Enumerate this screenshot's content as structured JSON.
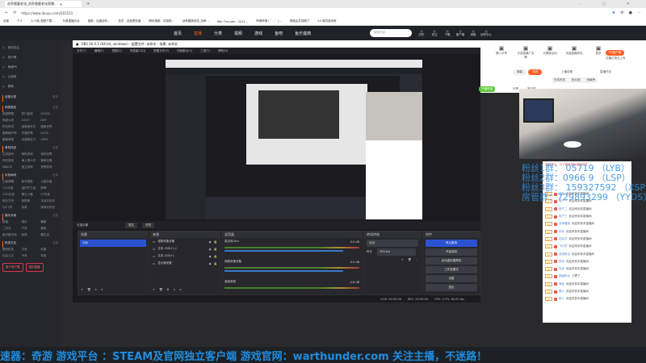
{
  "browser": {
    "tab_title": "战争雷霆老张_战争雷霆老张直播...",
    "url": "https://www.douyu.com/201521",
    "bookmarks": [
      "百度",
      "个人",
      "人人网_视频下载...",
      "抖音直播平台",
      "度娘 - 百度百科...",
      "花花 - 这就是知道",
      "腾讯视频 - 中国领...",
      "战争雷霆老张_战争...",
      "War Thunder - 2021...",
      "哔哩哔哩 ( ゜- ゜)...",
      "视频会员到期了",
      "24 单机游戏网"
    ]
  },
  "douyu": {
    "nav": [
      "首页",
      "直播",
      "分类",
      "视频",
      "游戏",
      "鱼吧",
      "鱼乐盛典"
    ],
    "search_placeholder": "搜索内容",
    "header_icons": [
      "历史",
      "关注",
      "下载",
      "客户端",
      "消息",
      "创作中心"
    ],
    "sidebar": {
      "top": [
        "我的关注",
        "排行榜",
        "鱼塘PK",
        "云游戏",
        "赛事"
      ],
      "sections": [
        {
          "title": "全部分类",
          "more": "更多",
          "items": []
        },
        {
          "title": "网游竞技",
          "more": "全部",
          "items": [
            "英雄联盟",
            "热门游戏",
            "DOTA2",
            "穿越火线",
            "CSGO",
            "DNF",
            "炉石传说",
            "逃离塔科夫",
            "魔兽世界",
            "暗黑破坏神",
            "守望先锋",
            "DOTA",
            "魔兽争霸",
            "天涯明月刀",
            "APEX"
          ]
        },
        {
          "title": "单机热游",
          "more": "全部",
          "items": [
            "主机游戏",
            "单机游戏",
            "我的世界",
            "怀旧游戏",
            "海上狼人杀",
            "使命召唤",
            "NBA2K",
            "独立游戏",
            "恐怖游戏"
          ]
        },
        {
          "title": "手游休闲",
          "more": "全部",
          "items": [
            "王者荣耀",
            "和平精英",
            "火影忍者",
            "LOL手游",
            "金铲铲之战",
            "原神",
            "COD手游",
            "第五人格",
            "CF手游",
            "明日方舟",
            "阴阳师",
            "决战平安京",
            "QQ飞车",
            "传奇",
            "球球大作战"
          ]
        },
        {
          "title": "娱乐天地",
          "more": "全部",
          "items": [
            "颜值",
            "音乐",
            "舞蹈",
            "二次元",
            "户外",
            "美食",
            "鱼乐星天地",
            "影视",
            "趣生活"
          ]
        },
        {
          "title": "科技文化",
          "more": "全部",
          "items": [
            "数码科技",
            "文化",
            "科普",
            "社会人文",
            "汽车",
            "军事"
          ]
        }
      ],
      "buttons": [
        "客户端下载",
        "我的直播"
      ]
    },
    "right": {
      "icons": [
        "猜人分享",
        "手游直播广告牌",
        "大蛋糕活动",
        "安装直播伴侣",
        "更多"
      ],
      "pc_button": "PC客户端",
      "pc_sub": "边播边录边上传",
      "toggle": [
        "弹幕",
        "关闭"
      ],
      "links": [
        "上播攻略",
        "直播任务"
      ],
      "tabs": [
        "在线贵宾",
        "粉丝团",
        "贡献榜"
      ],
      "green_btn": "开通贵族",
      "share": "分享",
      "report": "客户端"
    }
  },
  "obs": {
    "title": "OBS 26.0.1 (64-bit, windows) - 配置文件: 未命名 - 场景: 未命名",
    "menu": [
      "文件(F)",
      "编辑(E)",
      "视图(V)",
      "停靠窗口(D)",
      "配置文件(P)",
      "场景集合(S)",
      "工具(T)",
      "帮助(H)"
    ],
    "no_source": "无选中源",
    "props": "属性",
    "filters": "滤镜",
    "scenes_title": "场景",
    "scene": "场景",
    "sources_title": "来源",
    "sources": [
      "视频采集设备",
      "文本 (GDI+) 2",
      "文本 (GDI+)",
      "显示器采集"
    ],
    "mixer_title": "混音器",
    "mixer": [
      {
        "name": "麦克风/Aux",
        "db": "0.0 dB"
      },
      {
        "name": "视频采集设备",
        "db": "0.0 dB"
      },
      {
        "name": "桌面音频",
        "db": "-4.8 dB"
      }
    ],
    "transitions_title": "转场特效",
    "transition": "淡出",
    "duration_label": "时长",
    "duration": "300 ms",
    "controls_title": "控件",
    "controls": [
      "停止推流",
      "开始录制",
      "启动虚拟摄像机",
      "工作室模式",
      "设置",
      "退出"
    ],
    "status": {
      "live": "LIVE: 00:00:00",
      "rec": "REC: 00:00:00",
      "cpu": "CPU: 3.7%, 60.00 fps"
    }
  },
  "fans": [
    "粉丝1群：    05719 （LYB）",
    "粉丝2群：0966   9  （LSP）",
    "粉丝3群： 159327592 （XSP）",
    "房管群：729893299 （YYDS）"
  ],
  "chat": {
    "notice": "系统提示：为了倡导绿色直播环境...",
    "messages": [
      {
        "lvl": "LV",
        "user": "游客",
        "text": "欢迎来到本直播间"
      },
      {
        "lvl": "LV",
        "user": "用户一",
        "text": "欢迎来到本直播间"
      },
      {
        "lvl": "LV",
        "user": "用户二",
        "text": "欢迎来到本直播间"
      },
      {
        "lvl": "LV",
        "user": "用户三",
        "text": "欢迎来到本直播间"
      },
      {
        "lvl": "LV",
        "user": "战争雷霆",
        "text": "欢迎来到本直播间"
      },
      {
        "lvl": "LV",
        "user": "玩家",
        "text": "欢迎来到本直播间"
      },
      {
        "lvl": "LV",
        "user": "坦克手",
        "text": "欢迎来到本直播间"
      },
      {
        "lvl": "LV",
        "user": "飞行员",
        "text": "欢迎来到本直播间"
      },
      {
        "lvl": "LV",
        "user": "老张粉丝",
        "text": "欢迎来到本直播间"
      },
      {
        "lvl": "LV",
        "user": "陆战",
        "text": "欢迎来到本直播间"
      },
      {
        "lvl": "LV",
        "user": "空战",
        "text": "欢迎来到本直播间"
      },
      {
        "lvl": "LV",
        "user": "超级粉丝",
        "text": "习惯了"
      },
      {
        "lvl": "LV",
        "user": "海战",
        "text": "欢迎来到本直播间"
      },
      {
        "lvl": "LV",
        "user": "路人",
        "text": "欢迎来到本直播间"
      },
      {
        "lvl": "LV",
        "user": "新人",
        "text": "欢迎来到本直播间"
      }
    ]
  },
  "ticker": "速器：奇游   游戏平台  ：STEAM及官网独立客户端   游戏官网：warthunder.com 关注主播，不迷路！"
}
